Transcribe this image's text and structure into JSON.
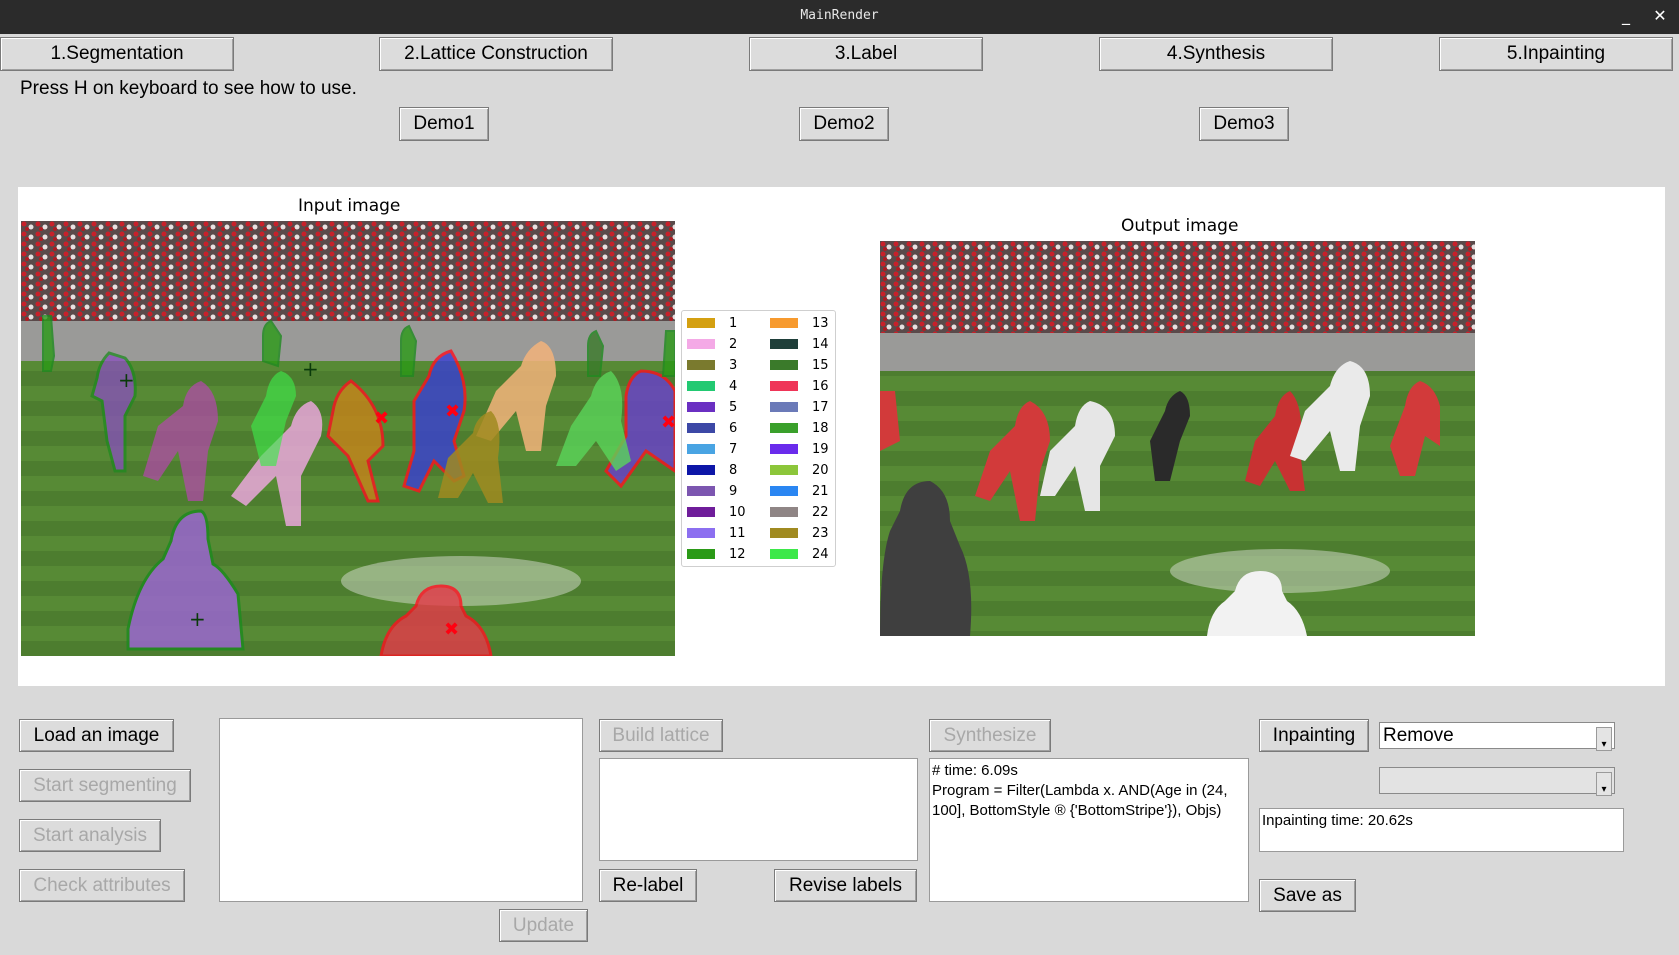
{
  "window": {
    "title": "MainRender",
    "minimize_label": "_",
    "close_label": "✕"
  },
  "tabs": [
    {
      "label": "1.Segmentation"
    },
    {
      "label": "2.Lattice Construction"
    },
    {
      "label": "3.Label"
    },
    {
      "label": "4.Synthesis"
    },
    {
      "label": "5.Inpainting"
    }
  ],
  "hint_text": "Press H on keyboard to see how to use.",
  "demos": [
    {
      "label": "Demo1"
    },
    {
      "label": "Demo2"
    },
    {
      "label": "Demo3"
    }
  ],
  "figure": {
    "input_title": "Input image",
    "output_title": "Output image",
    "legend": [
      {
        "label": "1",
        "color": "#d4a011"
      },
      {
        "label": "2",
        "color": "#f4a9e6"
      },
      {
        "label": "3",
        "color": "#7a7a2e"
      },
      {
        "label": "4",
        "color": "#22c972"
      },
      {
        "label": "5",
        "color": "#6a2fc2"
      },
      {
        "label": "6",
        "color": "#3c48a6"
      },
      {
        "label": "7",
        "color": "#49a4e3"
      },
      {
        "label": "8",
        "color": "#0d16a8"
      },
      {
        "label": "9",
        "color": "#7c56b0"
      },
      {
        "label": "10",
        "color": "#6f1d9a"
      },
      {
        "label": "11",
        "color": "#8c6ff0"
      },
      {
        "label": "12",
        "color": "#2b9a17"
      },
      {
        "label": "13",
        "color": "#f79a2e"
      },
      {
        "label": "14",
        "color": "#1f3f3a"
      },
      {
        "label": "15",
        "color": "#3a7a2a"
      },
      {
        "label": "16",
        "color": "#ef3558"
      },
      {
        "label": "17",
        "color": "#6b7ab8"
      },
      {
        "label": "18",
        "color": "#3aa02b"
      },
      {
        "label": "19",
        "color": "#6a2bec"
      },
      {
        "label": "20",
        "color": "#8cc63a"
      },
      {
        "label": "21",
        "color": "#2a86f2"
      },
      {
        "label": "22",
        "color": "#8f8585"
      },
      {
        "label": "23",
        "color": "#a08a20"
      },
      {
        "label": "24",
        "color": "#3de84a"
      }
    ]
  },
  "controls": {
    "load_image": "Load an image",
    "start_segmenting": "Start segmenting",
    "start_analysis": "Start analysis",
    "check_attributes": "Check attributes",
    "update": "Update",
    "build_lattice": "Build lattice",
    "re_label": "Re-label",
    "revise_labels": "Revise labels",
    "synthesize": "Synthesize",
    "synthesis_output": "# time: 6.09s\nProgram = Filter(Lambda x. AND(Age in (24, 100], BottomStyle ® {'BottomStripe'}), Objs)",
    "inpainting": "Inpainting",
    "inpaint_mode": "Remove",
    "inpaint_secondary": "",
    "inpainting_time": "Inpainting time: 20.62s",
    "save_as": "Save as"
  }
}
